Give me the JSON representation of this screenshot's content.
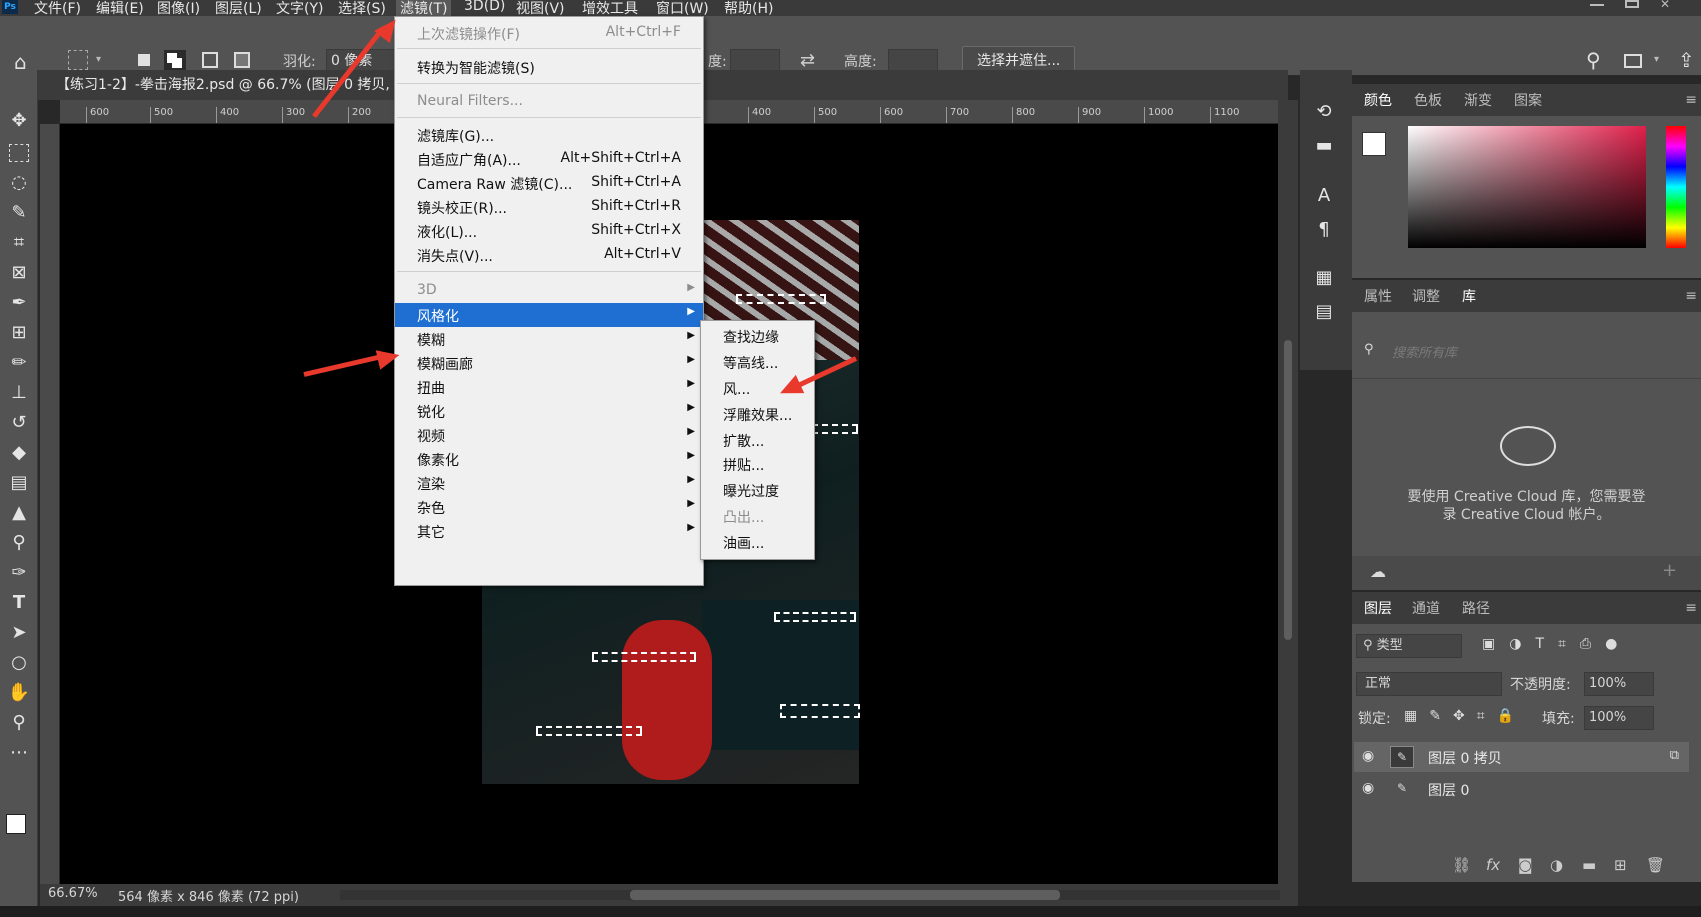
{
  "menubar": {
    "logo": "Ps",
    "items": [
      "文件(F)",
      "编辑(E)",
      "图像(I)",
      "图层(L)",
      "文字(Y)",
      "选择(S)",
      "滤镜(T)",
      "3D(D)",
      "视图(V)",
      "增效工具",
      "窗口(W)",
      "帮助(H)"
    ]
  },
  "options": {
    "feather_label": "羽化:",
    "feather_value": "0 像素",
    "opacity_fragment": "度:",
    "height_label": "高度:",
    "select_mask_button": "选择并遮住..."
  },
  "document": {
    "tab_title": "【练习1-2】-拳击海报2.psd @ 66.7% (图层 0 拷贝,"
  },
  "ruler": {
    "h_ticks": [
      "600",
      "500",
      "400",
      "300",
      "200",
      "400",
      "500",
      "600",
      "700",
      "800",
      "900",
      "1000",
      "1100"
    ]
  },
  "status": {
    "zoom": "66.67%",
    "dimensions": "564 像素 x 846 像素 (72 ppi)"
  },
  "filter_menu": {
    "items": [
      {
        "label": "上次滤镜操作(F)",
        "shortcut": "Alt+Ctrl+F",
        "disabled": true
      },
      {
        "label": "转换为智能滤镜(S)",
        "shortcut": ""
      },
      {
        "label": "Neural Filters...",
        "shortcut": "",
        "disabled": true
      },
      {
        "label": "滤镜库(G)...",
        "shortcut": ""
      },
      {
        "label": "自适应广角(A)...",
        "shortcut": "Alt+Shift+Ctrl+A"
      },
      {
        "label": "Camera Raw 滤镜(C)...",
        "shortcut": "Shift+Ctrl+A"
      },
      {
        "label": "镜头校正(R)...",
        "shortcut": "Shift+Ctrl+R"
      },
      {
        "label": "液化(L)...",
        "shortcut": "Shift+Ctrl+X"
      },
      {
        "label": "消失点(V)...",
        "shortcut": "Alt+Ctrl+V"
      },
      {
        "label": "3D",
        "submenu": true,
        "disabled": true
      },
      {
        "label": "风格化",
        "submenu": true,
        "highlighted": true
      },
      {
        "label": "模糊",
        "submenu": true
      },
      {
        "label": "模糊画廊",
        "submenu": true
      },
      {
        "label": "扭曲",
        "submenu": true
      },
      {
        "label": "锐化",
        "submenu": true
      },
      {
        "label": "视频",
        "submenu": true
      },
      {
        "label": "像素化",
        "submenu": true
      },
      {
        "label": "渲染",
        "submenu": true
      },
      {
        "label": "杂色",
        "submenu": true
      },
      {
        "label": "其它",
        "submenu": true
      }
    ]
  },
  "stylize_submenu": {
    "items": [
      {
        "label": "查找边缘"
      },
      {
        "label": "等高线..."
      },
      {
        "label": "风..."
      },
      {
        "label": "浮雕效果..."
      },
      {
        "label": "扩散..."
      },
      {
        "label": "拼贴..."
      },
      {
        "label": "曝光过度"
      },
      {
        "label": "凸出...",
        "disabled": true
      },
      {
        "label": "油画..."
      }
    ]
  },
  "color_panel": {
    "tabs": [
      "颜色",
      "色板",
      "渐变",
      "图案"
    ],
    "active_tab": "颜色",
    "foreground": "#ffffff",
    "hue_accent": "#e0204a"
  },
  "library_panel": {
    "tabs": [
      "属性",
      "调整",
      "库"
    ],
    "active_tab": "库",
    "search_placeholder": "搜索所有库",
    "message_line1": "要使用 Creative Cloud 库，您需要登",
    "message_line2": "录 Creative Cloud 帐户。"
  },
  "layers_panel": {
    "tabs": [
      "图层",
      "通道",
      "路径"
    ],
    "active_tab": "图层",
    "filter_label": "类型",
    "blend_mode": "正常",
    "opacity_label": "不透明度:",
    "opacity_value": "100%",
    "lock_label": "锁定:",
    "fill_label": "填充:",
    "fill_value": "100%",
    "layers": [
      {
        "name": "图层 0 拷贝",
        "selected": true
      },
      {
        "name": "图层 0",
        "selected": false
      }
    ]
  },
  "colors": {
    "menu_highlight": "#1e6fd1",
    "annotation_arrow": "#e8392c"
  }
}
